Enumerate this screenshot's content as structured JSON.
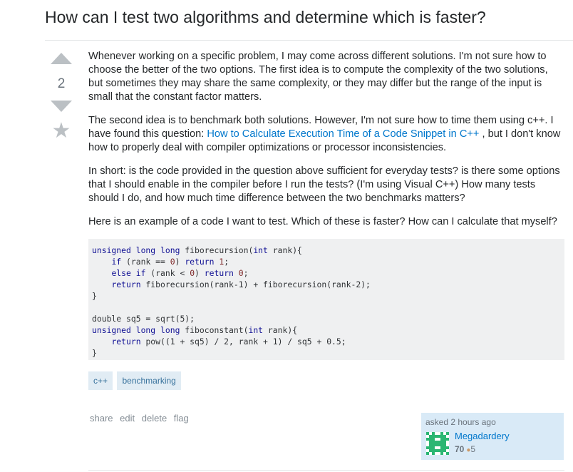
{
  "question": {
    "title": "How can I test two algorithms and determine which is faster?",
    "votes": "2"
  },
  "body": {
    "p1": "Whenever working on a specific problem, I may come across different solutions. I'm not sure how to choose the better of the two options. The first idea is to compute the complexity of the two solutions, but sometimes they may share the same complexity, or they may differ but the range of the input is small that the constant factor matters.",
    "p2_before": "The second idea is to benchmark both solutions. However, I'm not sure how to time them using c++. I have found this question: ",
    "p2_link": "How to Calculate Execution Time of a Code Snippet in C++",
    "p2_after": " , but I don't know how to properly deal with compiler optimizations or processor inconsistencies.",
    "p3": "In short: is the code provided in the question above sufficient for everyday tests? is there some options that I should enable in the compiler before I run the tests? (I'm using Visual C++) How many tests should I do, and how much time difference between the two benchmarks matters?",
    "p4": "Here is an example of a code I want to test. Which of these is faster? How can I calculate that myself?"
  },
  "code": {
    "l1_kw": "unsigned long long",
    "l1_fn": " fiborecursion(",
    "l1_kw2": "int",
    "l1_end": " rank){",
    "l2_ind": "    ",
    "l2_kw": "if",
    "l2_mid": " (rank == ",
    "l2_num": "0",
    "l2_mid2": ") ",
    "l2_kw2": "return",
    "l2_num2": " 1",
    "l2_end": ";",
    "l3_ind": "    ",
    "l3_kw": "else if",
    "l3_mid": " (rank < ",
    "l3_num": "0",
    "l3_mid2": ") ",
    "l3_kw2": "return",
    "l3_num2": " 0",
    "l3_end": ";",
    "l4_ind": "    ",
    "l4_kw": "return",
    "l4_rest": " fiborecursion(rank-1) + fiborecursion(rank-2);",
    "l5": "}",
    "l7": "double sq5 = sqrt(5);",
    "l8_kw": "unsigned long long",
    "l8_fn": " fiboconstant(",
    "l8_kw2": "int",
    "l8_end": " rank){",
    "l9_ind": "    ",
    "l9_kw": "return",
    "l9_rest": " pow((1 + sq5) / 2, rank + 1) / sq5 + 0.5;",
    "l10": "}"
  },
  "tags": [
    "c++",
    "benchmarking"
  ],
  "menu": {
    "share": "share",
    "edit": "edit",
    "delete": "delete",
    "flag": "flag"
  },
  "owner": {
    "asked": "asked 2 hours ago",
    "name": "Megadardery",
    "reputation": "70",
    "bronze_badges": "5",
    "bronze_dot": "●"
  },
  "icons": {
    "vote_up": "arrow-up-icon",
    "vote_down": "arrow-down-icon",
    "favorite": "star-icon",
    "star_glyph": "★"
  },
  "colors": {
    "link": "#0077cc",
    "tag_bg": "#e1ecf4",
    "tag_text": "#39739d",
    "owner_bg": "#d9eaf7",
    "code_bg": "#eff0f1",
    "bronze": "#cc9966"
  }
}
